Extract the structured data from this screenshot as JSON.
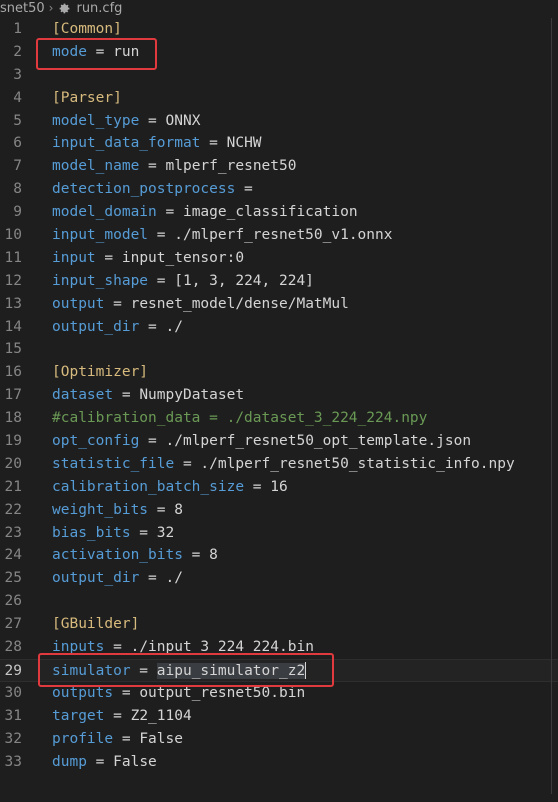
{
  "breadcrumb": {
    "folder": "snet50",
    "file": "run.cfg",
    "file_icon": "gear-icon",
    "separator_icon": "chevron-right-icon"
  },
  "editor": {
    "current_line": "29",
    "lines": [
      {
        "num": "1",
        "section": "[Common]"
      },
      {
        "num": "2",
        "key": "mode",
        "value": "run"
      },
      {
        "num": "3"
      },
      {
        "num": "4",
        "section": "[Parser]"
      },
      {
        "num": "5",
        "key": "model_type",
        "value": "ONNX"
      },
      {
        "num": "6",
        "key": "input_data_format",
        "value": "NCHW"
      },
      {
        "num": "7",
        "key": "model_name",
        "value": "mlperf_resnet50"
      },
      {
        "num": "8",
        "key": "detection_postprocess",
        "value": ""
      },
      {
        "num": "9",
        "key": "model_domain",
        "value": "image_classification"
      },
      {
        "num": "10",
        "key": "input_model",
        "value": "./mlperf_resnet50_v1.onnx"
      },
      {
        "num": "11",
        "key": "input",
        "value": "input_tensor:0"
      },
      {
        "num": "12",
        "key": "input_shape",
        "value": "[1, 3, 224, 224]"
      },
      {
        "num": "13",
        "key": "output",
        "value": "resnet_model/dense/MatMul"
      },
      {
        "num": "14",
        "key": "output_dir",
        "value": "./"
      },
      {
        "num": "15"
      },
      {
        "num": "16",
        "section": "[Optimizer]"
      },
      {
        "num": "17",
        "key": "dataset",
        "value": "NumpyDataset"
      },
      {
        "num": "18",
        "comment": "#calibration_data = ./dataset_3_224_224.npy"
      },
      {
        "num": "19",
        "key": "opt_config",
        "value": "./mlperf_resnet50_opt_template.json"
      },
      {
        "num": "20",
        "key": "statistic_file",
        "value": "./mlperf_resnet50_statistic_info.npy"
      },
      {
        "num": "21",
        "key": "calibration_batch_size",
        "value": "16"
      },
      {
        "num": "22",
        "key": "weight_bits",
        "value": "8"
      },
      {
        "num": "23",
        "key": "bias_bits",
        "value": "32"
      },
      {
        "num": "24",
        "key": "activation_bits",
        "value": "8"
      },
      {
        "num": "25",
        "key": "output_dir",
        "value": "./"
      },
      {
        "num": "26"
      },
      {
        "num": "27",
        "section": "[GBuilder]"
      },
      {
        "num": "28",
        "key": "inputs",
        "value": "./input_3_224_224.bin"
      },
      {
        "num": "29",
        "key": "simulator",
        "value": "aipu_simulator_z2"
      },
      {
        "num": "30",
        "key": "outputs",
        "value": "output_resnet50.bin"
      },
      {
        "num": "31",
        "key": "target",
        "value": "Z2_1104"
      },
      {
        "num": "32",
        "key": "profile",
        "value": "False"
      },
      {
        "num": "33",
        "key": "dump",
        "value": "False"
      }
    ]
  },
  "colors": {
    "background": "#1e1e1e",
    "section": "#d7ba7d",
    "key": "#569cd6",
    "text": "#d4d4d4",
    "comment": "#6a9955",
    "highlight_box": "#e0393e"
  }
}
